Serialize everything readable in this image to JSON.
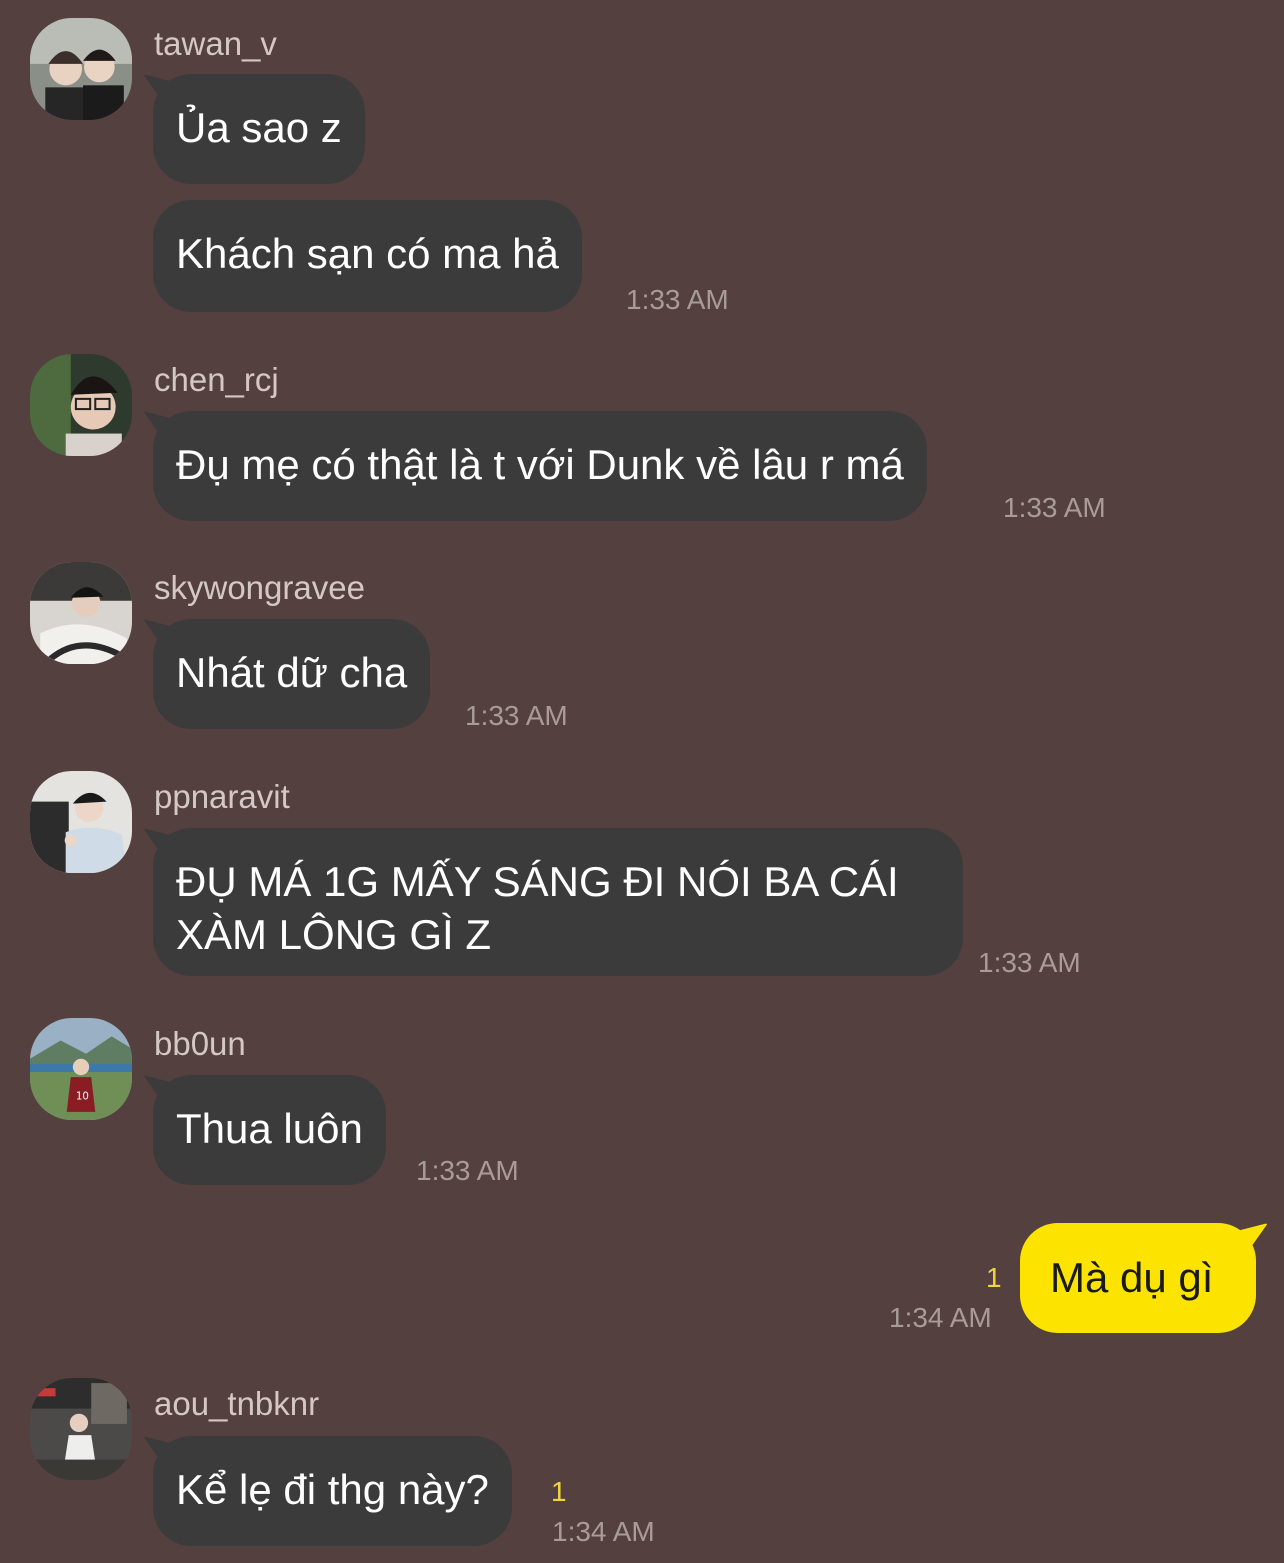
{
  "messages": [
    {
      "user": "tawan_v",
      "lines": [
        "Ủa sao z",
        "Khách sạn có ma hả"
      ],
      "time": "1:33 AM"
    },
    {
      "user": "chen_rcj",
      "lines": [
        "Đụ mẹ có thật là t với Dunk về lâu r má"
      ],
      "time": "1:33 AM"
    },
    {
      "user": "skywongravee",
      "lines": [
        "Nhát dữ cha"
      ],
      "time": "1:33 AM"
    },
    {
      "user": "ppnaravit",
      "lines": [
        "ĐỤ MÁ 1G MẤY SÁNG ĐI NÓI BA CÁI\nXÀM LÔNG GÌ Z"
      ],
      "time": "1:33 AM"
    },
    {
      "user": "bb0un",
      "lines": [
        "Thua luôn"
      ],
      "time": "1:33 AM"
    },
    {
      "user": "aou_tnbknr",
      "lines": [
        "Kể lẹ đi thg này?"
      ],
      "time": "1:34 AM",
      "unread": "1"
    }
  ],
  "my_message": {
    "text": "Mà dụ gì",
    "time": "1:34 AM",
    "unread": "1"
  },
  "colors": {
    "background": "#554040",
    "bubble": "#3c3b3c",
    "my_bubble": "#fde400",
    "unread": "#f2d53c"
  },
  "avatars": [
    "avatar-photo-tawan",
    "avatar-photo-chen",
    "avatar-photo-sky",
    "avatar-photo-ppnaravit",
    "avatar-photo-bb0un",
    "avatar-photo-aou"
  ]
}
